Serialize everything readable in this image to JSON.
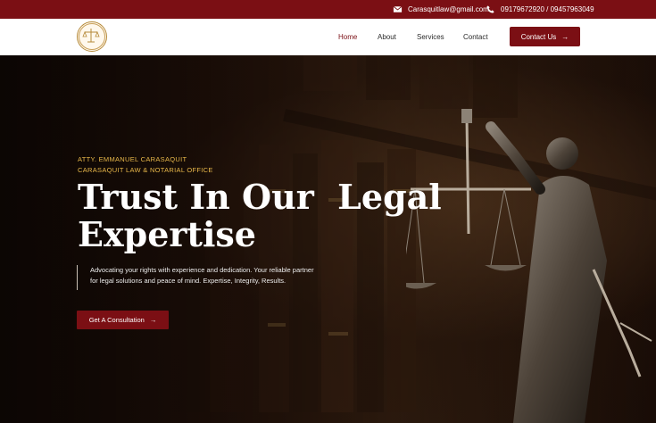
{
  "topbar": {
    "email": "Carasquitlaw@gmail.com",
    "phone": "09179672920 / 09457963049",
    "email_icon": "mail-icon",
    "phone_icon": "phone-icon"
  },
  "nav": {
    "logo": "law-office-seal-logo",
    "items": [
      {
        "label": "Home",
        "active": true
      },
      {
        "label": "About"
      },
      {
        "label": "Services"
      },
      {
        "label": "Contact"
      }
    ],
    "cta_label": "Contact Us"
  },
  "hero": {
    "attorney_line": "ATTY. EMMANUEL CARASAQUIT",
    "office_line": "CARASAQUIT LAW & NOTARIAL OFFICE",
    "headline_line1": "Trust In Our  Legal",
    "headline_line2": "Expertise",
    "description": "Advocating your rights with experience and dedication. Your reliable partner for legal solutions and peace of  mind. Expertise, Integrity, Results.",
    "cta_label": "Get A Consultation",
    "image": "lady-justice-statue-with-books"
  },
  "colors": {
    "brand": "#7b0f14",
    "accent_gold": "#e8b84a"
  }
}
